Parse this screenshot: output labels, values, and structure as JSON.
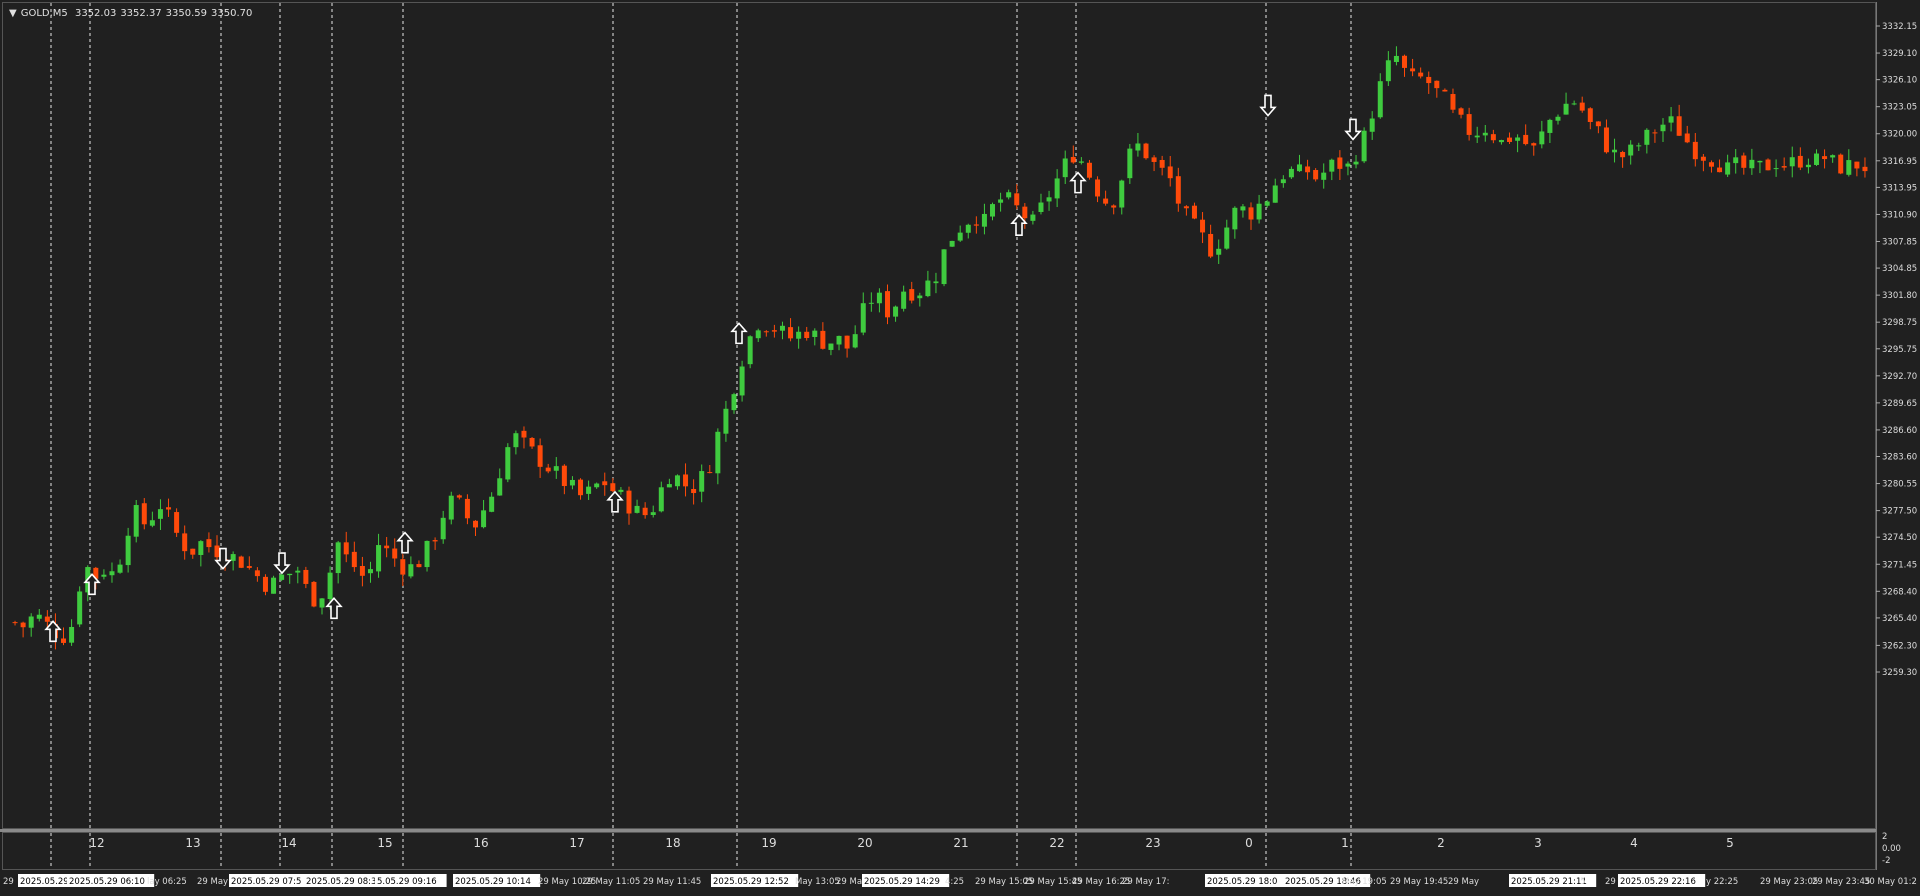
{
  "app": {
    "symbol_label": "GOLD,M5",
    "ohlc": [
      "3352.03",
      "3352.37",
      "3350.59",
      "3350.70"
    ]
  },
  "colors": {
    "background": "#202020",
    "bull": "#3fcb3f",
    "bear": "#ff4a0a",
    "grid": "#ffffff",
    "text": "#dddddd",
    "arrow": "#ffffff"
  },
  "price_axis": {
    "labels": [
      "3332.15",
      "3329.10",
      "3326.10",
      "3323.05",
      "3320.00",
      "3316.95",
      "3313.95",
      "3310.90",
      "3307.85",
      "3304.85",
      "3301.80",
      "3298.75",
      "3295.75",
      "3292.70",
      "3289.65",
      "3286.60",
      "3283.60",
      "3280.55",
      "3277.50",
      "3274.50",
      "3271.45",
      "3268.40",
      "3265.40",
      "3262.30",
      "3259.30"
    ]
  },
  "sub_axis": {
    "labels": [
      "2",
      "0.00",
      "-2"
    ]
  },
  "hour_labels": [
    "12",
    "13",
    "14",
    "15",
    "16",
    "17",
    "18",
    "19",
    "20",
    "21",
    "22",
    "23",
    "0",
    "1",
    "2",
    "3",
    "4",
    "5"
  ],
  "time_axis": {
    "labels": [
      {
        "text": "29 ",
        "boxed": false
      },
      {
        "text": "2025.05.29 05:2",
        "boxed": true
      },
      {
        "text": "2025.05.29 06:10",
        "boxed": true
      },
      {
        "text": "lay 06:25",
        "boxed": false
      },
      {
        "text": "29 May",
        "boxed": false
      },
      {
        "text": "2025.05.29 07:5",
        "boxed": true
      },
      {
        "text": "2025.05.29 08:35",
        "boxed": true
      },
      {
        "text": "5.05.29 09:16",
        "boxed": true
      },
      {
        "text": "2025.05.29 10:14",
        "boxed": true
      },
      {
        "text": "29 May 10:25",
        "boxed": false
      },
      {
        "text": "29 May 11:05",
        "boxed": false
      },
      {
        "text": "29 May 11:45",
        "boxed": false
      },
      {
        "text": "2025.05.29 12:52",
        "boxed": true
      },
      {
        "text": "May 13:05",
        "boxed": false
      },
      {
        "text": "29 Ma",
        "boxed": false
      },
      {
        "text": "2025.05.29 14:29",
        "boxed": true
      },
      {
        "text": "4:25",
        "boxed": false
      },
      {
        "text": "29 May 15:05",
        "boxed": false
      },
      {
        "text": "29 May 15:45",
        "boxed": false
      },
      {
        "text": "29 May 16:25",
        "boxed": false
      },
      {
        "text": "29 May 17:",
        "boxed": false
      },
      {
        "text": "2025.05.29 18:0",
        "boxed": true
      },
      {
        "text": "2025.05.29 18:46",
        "boxed": true
      },
      {
        "text": "May 19:05",
        "boxed": false
      },
      {
        "text": "29 May 19:45",
        "boxed": false
      },
      {
        "text": "29 May",
        "boxed": false
      },
      {
        "text": "2025.05.29 21:11",
        "boxed": true
      },
      {
        "text": "5",
        "boxed": false
      },
      {
        "text": "29 May",
        "boxed": false
      },
      {
        "text": "2025.05.29 22:16",
        "boxed": true
      },
      {
        "text": "y 22:25",
        "boxed": false
      },
      {
        "text": "29 May 23:05",
        "boxed": false
      },
      {
        "text": "29 May 23:45",
        "boxed": false
      },
      {
        "text": "30 May 01:2",
        "boxed": false
      }
    ]
  },
  "chart_data": {
    "type": "candlestick",
    "symbol": "GOLD",
    "timeframe": "M5",
    "ylim": [
      3257.8,
      3333.6
    ],
    "y_ticks": [
      3332.15,
      3329.1,
      3326.1,
      3323.05,
      3320.0,
      3316.95,
      3313.95,
      3310.9,
      3307.85,
      3304.85,
      3301.8,
      3298.75,
      3295.75,
      3292.7,
      3289.65,
      3286.6,
      3283.6,
      3280.55,
      3277.5,
      3274.5,
      3271.45,
      3268.4,
      3265.4,
      3262.3,
      3259.3
    ],
    "close_path": [
      3265,
      3264.5,
      3266,
      3265,
      3264,
      3263.5,
      3265,
      3272,
      3270,
      3271,
      3270.5,
      3273,
      3278,
      3276,
      3277,
      3278.5,
      3276,
      3274,
      3273,
      3274,
      3273.5,
      3273,
      3272.5,
      3272,
      3271,
      3270,
      3269,
      3270,
      3270.5,
      3271,
      3268,
      3267.5,
      3270,
      3274,
      3272,
      3271,
      3269.5,
      3274,
      3273,
      3272,
      3271,
      3271.5,
      3273,
      3275,
      3278,
      3279,
      3277,
      3276,
      3278,
      3280,
      3284,
      3286,
      3285,
      3284,
      3283,
      3282,
      3281,
      3280,
      3279,
      3280,
      3281,
      3280,
      3279,
      3278,
      3277,
      3277.5,
      3280,
      3282,
      3281,
      3280,
      3281,
      3283,
      3287,
      3290,
      3294,
      3297,
      3299,
      3298.5,
      3298,
      3297,
      3297.5,
      3298,
      3297,
      3296.5,
      3297,
      3296,
      3298,
      3301,
      3302,
      3300,
      3301,
      3303,
      3302,
      3303,
      3304,
      3307,
      3309,
      3310,
      3311,
      3310,
      3312,
      3313,
      3312,
      3311,
      3310,
      3312,
      3314,
      3316,
      3318,
      3317,
      3315,
      3313,
      3312,
      3315,
      3318,
      3319,
      3317,
      3316,
      3315,
      3312,
      3310,
      3309,
      3307,
      3308,
      3310,
      3312,
      3311,
      3312,
      3313,
      3315,
      3316,
      3315.5,
      3316,
      3315,
      3316,
      3317,
      3316,
      3318,
      3320,
      3324,
      3327,
      3329,
      3327,
      3326,
      3326.5,
      3325,
      3324,
      3322,
      3321,
      3320,
      3321,
      3320,
      3319,
      3320,
      3319.5,
      3318,
      3320,
      3322,
      3323,
      3324,
      3323,
      3321,
      3320,
      3318,
      3317.5,
      3318,
      3319,
      3320,
      3321,
      3321.5,
      3320.5,
      3319,
      3318,
      3317.5,
      3317,
      3316,
      3316.5,
      3316,
      3316.2,
      3316.5,
      3317,
      3316.5,
      3317,
      3317.5,
      3317,
      3317.5,
      3316.5,
      3316.3,
      3316.7,
      3316.4
    ],
    "signals": [
      {
        "type": "buy",
        "price": 3264.0
      },
      {
        "type": "buy",
        "price": 3269.3
      },
      {
        "type": "sell",
        "price": 3272.2
      },
      {
        "type": "sell",
        "price": 3271.7
      },
      {
        "type": "buy",
        "price": 3266.6
      },
      {
        "type": "buy",
        "price": 3274.0
      },
      {
        "type": "buy",
        "price": 3278.6
      },
      {
        "type": "buy",
        "price": 3297.6
      },
      {
        "type": "buy",
        "price": 3309.8
      },
      {
        "type": "buy",
        "price": 3314.6
      },
      {
        "type": "sell",
        "price": 3323.3
      },
      {
        "type": "sell",
        "price": 3320.6
      }
    ],
    "x_hours": [
      "12",
      "13",
      "14",
      "15",
      "16",
      "17",
      "18",
      "19",
      "20",
      "21",
      "22",
      "23",
      "0",
      "1",
      "2",
      "3",
      "4",
      "5"
    ],
    "grid": "vertical dashed at signal times"
  }
}
